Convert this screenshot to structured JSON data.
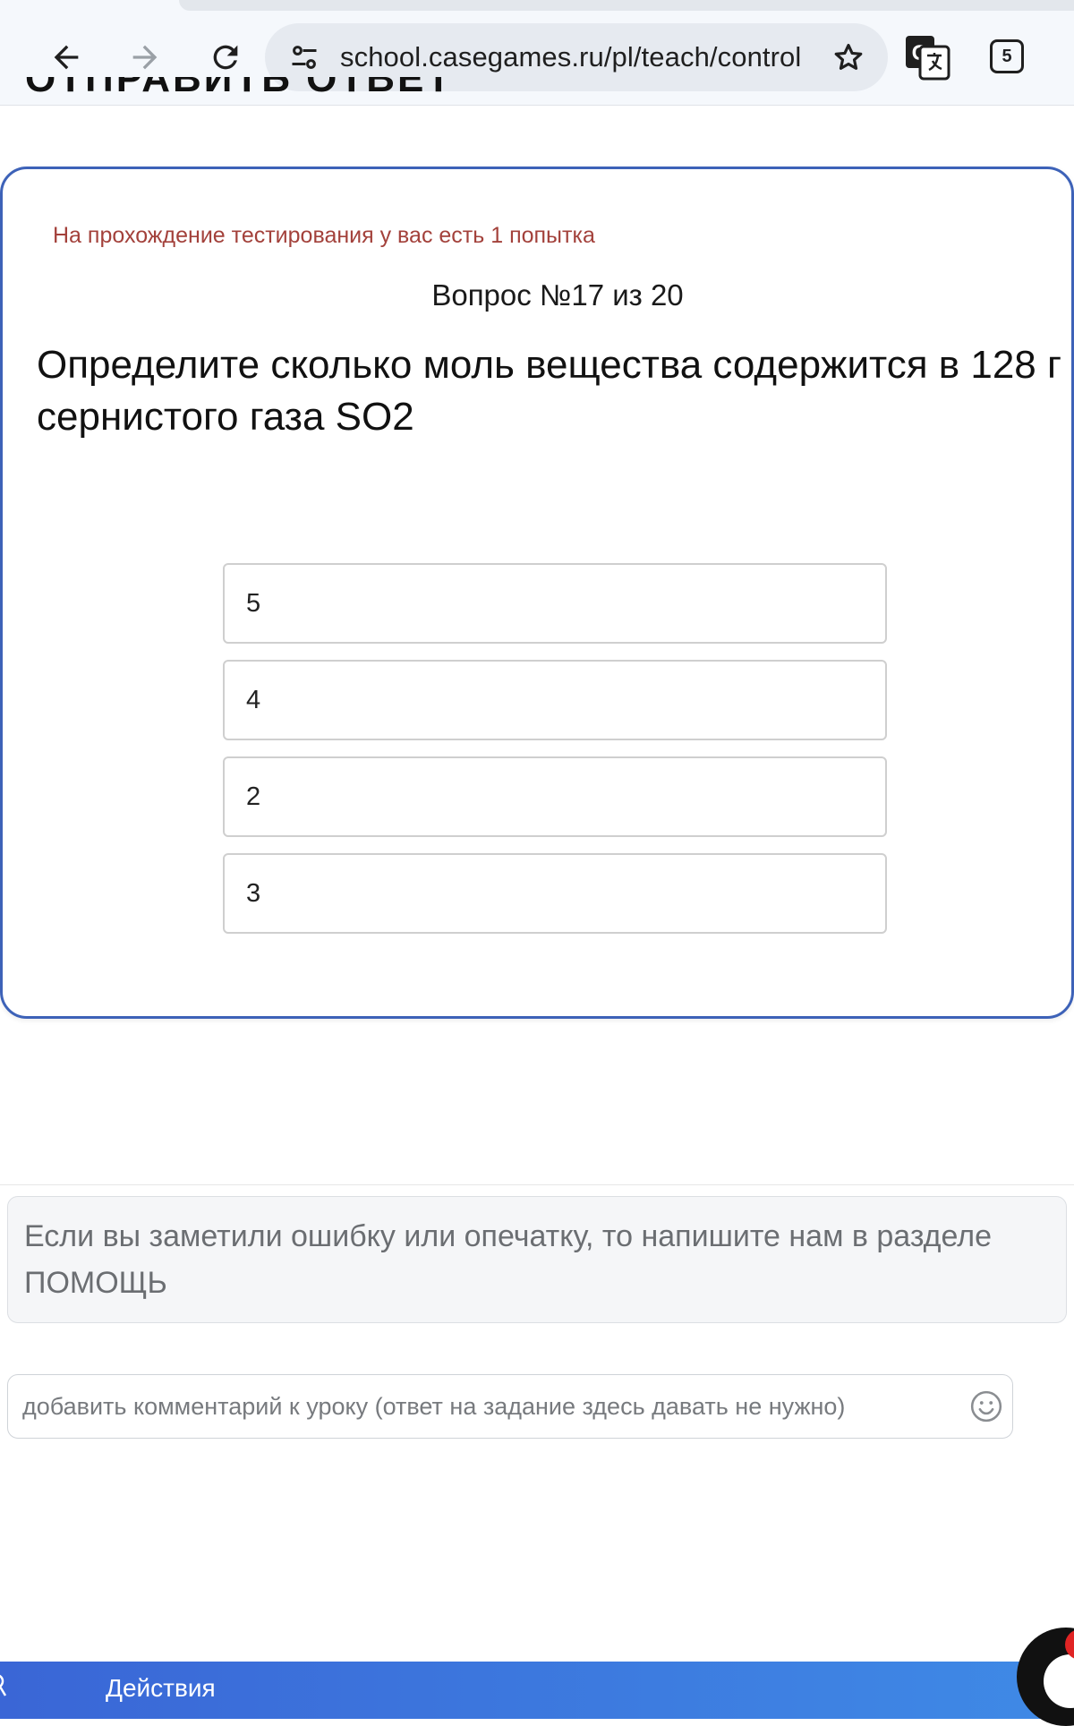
{
  "browser": {
    "url": "school.casegames.ru/pl/teach/control",
    "tab_count": "5",
    "icons": {
      "back": "arrow-left-icon",
      "forward": "arrow-right-icon",
      "reload": "reload-icon",
      "site_info": "tune-icon",
      "bookmark": "star-icon",
      "translate": "translate-icon",
      "tabs": "tab-switcher-icon"
    }
  },
  "page": {
    "cutoff_heading": "ОТПРАВИТЬ ОТВЕТ"
  },
  "quiz": {
    "attempts_note": "На прохождение тестирования у вас есть 1 попытка",
    "question_counter": "Вопрос №17 из 20",
    "question": "Определите сколько моль вещества содержится в 128 г сернистого газа SO2",
    "options": [
      "5",
      "4",
      "2",
      "3"
    ],
    "accent_color": "#3d62b8",
    "note_color": "#a3413b"
  },
  "help": {
    "text": "Если вы заметили ошибку или опечатку, то напишите нам в разделе ПОМОЩЬ"
  },
  "comment": {
    "placeholder": "добавить комментарий к уроку (ответ на задание здесь давать не нужно)",
    "icon": "emoji-icon"
  },
  "bottom_bar": {
    "label": "Действия",
    "color": "#3a66d6"
  }
}
